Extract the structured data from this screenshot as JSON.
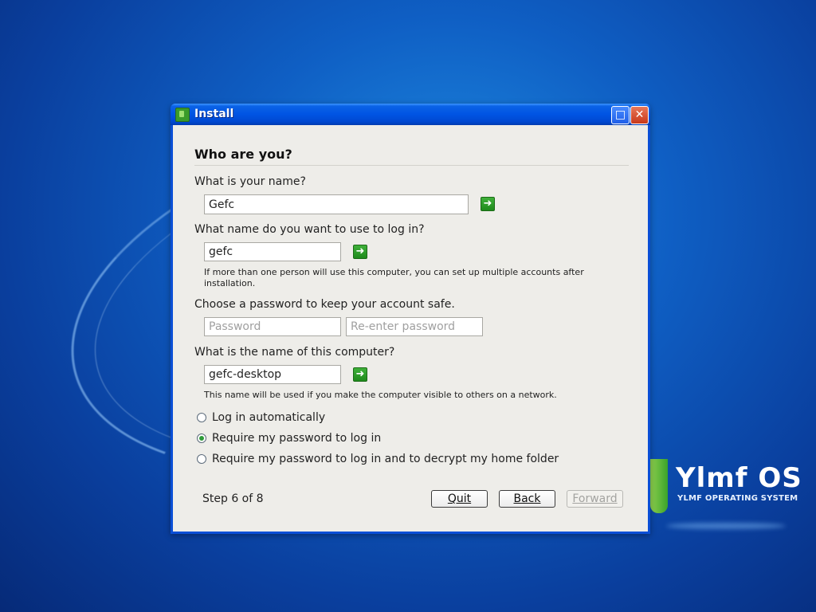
{
  "window": {
    "title": "Install"
  },
  "form": {
    "heading": "Who are you?",
    "name": {
      "label": "What is your name?",
      "value": "Gefc"
    },
    "login": {
      "label": "What name do you want to use to log in?",
      "value": "gefc",
      "hint": "If more than one person will use this computer, you can set up multiple accounts after installation."
    },
    "password": {
      "label": "Choose a password to keep your account safe.",
      "placeholder": "Password",
      "confirm_placeholder": "Re-enter password"
    },
    "computer": {
      "label": "What is the name of this computer?",
      "value": "gefc-desktop",
      "hint": "This name will be used if you make the computer visible to others on a network."
    },
    "login_options": [
      {
        "label": "Log in automatically",
        "selected": false
      },
      {
        "label": "Require my password to log in",
        "selected": true
      },
      {
        "label": "Require my password to log in and to decrypt my home folder",
        "selected": false
      }
    ]
  },
  "footer": {
    "step": "Step 6 of 8",
    "quit_label": "Quit",
    "back_label": "Back",
    "forward_label": "Forward",
    "forward_enabled": false
  },
  "brand": {
    "name": "Ylmf OS",
    "tagline": "YLMF OPERATING SYSTEM"
  },
  "colors": {
    "titlebar": "#0054e3",
    "client_bg": "#eeede9",
    "accent_green": "#2f9b3a",
    "close_button": "#c8381a"
  },
  "icons": {
    "app": "installer-icon",
    "go": "arrow-right-icon",
    "maximize": "maximize-icon",
    "close": "close-icon"
  }
}
